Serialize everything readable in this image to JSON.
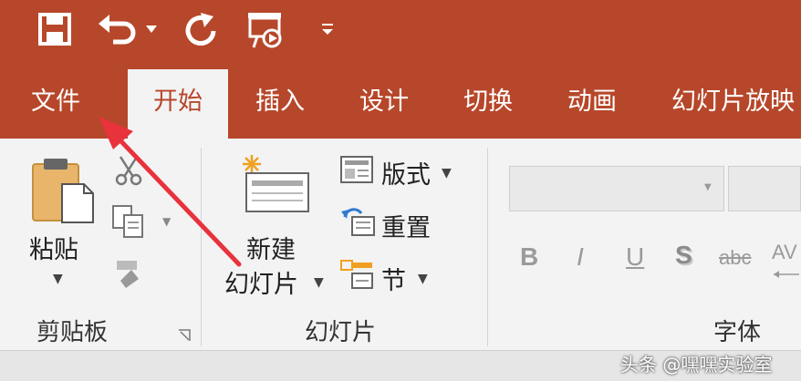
{
  "quick_access": {
    "icons": [
      "save-icon",
      "undo-icon",
      "redo-icon",
      "slideshow-icon",
      "customize-qat-icon"
    ]
  },
  "tabs": [
    {
      "label": "文件"
    },
    {
      "label": "开始",
      "active": true
    },
    {
      "label": "插入"
    },
    {
      "label": "设计"
    },
    {
      "label": "切换"
    },
    {
      "label": "动画"
    },
    {
      "label": "幻灯片放映"
    }
  ],
  "ribbon": {
    "clipboard": {
      "paste_label": "粘贴",
      "group_label": "剪贴板"
    },
    "slides": {
      "new_slide_label_line1": "新建",
      "new_slide_label_line2": "幻灯片",
      "layout_label": "版式",
      "reset_label": "重置",
      "section_label": "节",
      "group_label": "幻灯片"
    },
    "font": {
      "bold": "B",
      "italic": "I",
      "underline": "U",
      "shadow": "S",
      "strikethrough": "abc",
      "spacing": "AV",
      "group_label": "字体"
    }
  },
  "watermark": "头条 @嘿嘿实验室",
  "colors": {
    "accent": "#b7472a",
    "ribbon_bg": "#f3f3f3",
    "annotation_arrow": "#e8323c"
  }
}
